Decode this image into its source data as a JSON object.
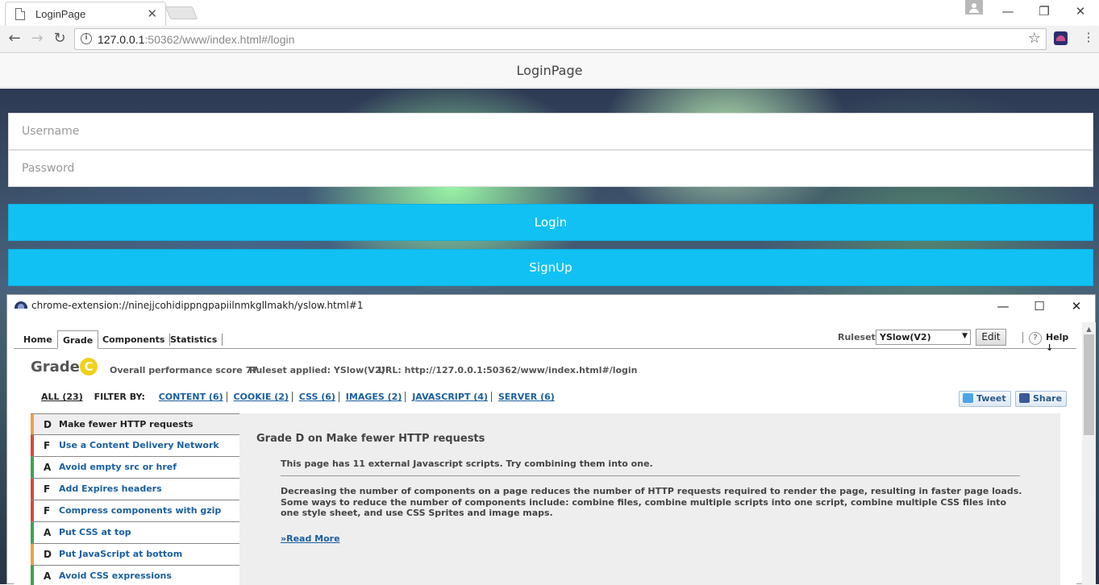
{
  "browser": {
    "tab_title": "LoginPage",
    "tab_close": "✕",
    "url_host": "127.0.0.1",
    "url_rest": ":50362/www/index.html#/login",
    "window_minimize": "—",
    "window_restore": "❐",
    "window_close": "✕",
    "back": "←",
    "forward": "→",
    "reload": "↻",
    "star": "☆",
    "menu": "⋮"
  },
  "app": {
    "header_title": "LoginPage",
    "username_placeholder": "Username",
    "password_placeholder": "Password",
    "login_label": "Login",
    "signup_label": "SignUp"
  },
  "yslow_window": {
    "title": "chrome-extension://ninejjcohidippngpapiilnmkgllmakh/yslow.html#1",
    "minimize": "—",
    "maximize": "☐",
    "close": "✕"
  },
  "yslow": {
    "tabs": [
      "Home",
      "Grade",
      "Components",
      "Statistics"
    ],
    "rulesets_label": "Rulesets",
    "ruleset_value": "YSlow(V2)",
    "edit_label": "Edit",
    "help_icon": "?",
    "help_label": "Help ↓",
    "grade_label": "Grade",
    "grade_letter": "C",
    "score_text": "Overall performance score 77",
    "ruleset_applied": "Ruleset applied: YSlow(V2)",
    "url_text": "URL: http://127.0.0.1:50362/www/index.html#/login",
    "filter_all": "ALL (23)",
    "filter_by": "FILTER BY:",
    "filters": [
      "CONTENT (6)",
      "COOKIE (2)",
      "CSS (6)",
      "IMAGES (2)",
      "JAVASCRIPT (4)",
      "SERVER (6)"
    ],
    "tweet_label": "Tweet",
    "share_label": "Share",
    "rules": [
      {
        "grade": "D",
        "name": "Make fewer HTTP requests",
        "color": "#f0a040"
      },
      {
        "grade": "F",
        "name": "Use a Content Delivery Network (CDN)",
        "color": "#d84a3a"
      },
      {
        "grade": "A",
        "name": "Avoid empty src or href",
        "color": "#3aa64a"
      },
      {
        "grade": "F",
        "name": "Add Expires headers",
        "color": "#d84a3a"
      },
      {
        "grade": "F",
        "name": "Compress components with gzip",
        "color": "#d84a3a"
      },
      {
        "grade": "A",
        "name": "Put CSS at top",
        "color": "#3aa64a"
      },
      {
        "grade": "D",
        "name": "Put JavaScript at bottom",
        "color": "#f0a040"
      },
      {
        "grade": "A",
        "name": "Avoid CSS expressions",
        "color": "#3aa64a"
      }
    ],
    "detail": {
      "title": "Grade D on Make fewer HTTP requests",
      "message": "This page has 11 external Javascript scripts. Try combining them into one.",
      "description": "Decreasing the number of components on a page reduces the number of HTTP requests required to render the page, resulting in faster page loads. Some ways to reduce the number of components include: combine files, combine multiple scripts into one script, combine multiple CSS files into one style sheet, and use CSS Sprites and image maps.",
      "read_more": "»Read More"
    }
  }
}
